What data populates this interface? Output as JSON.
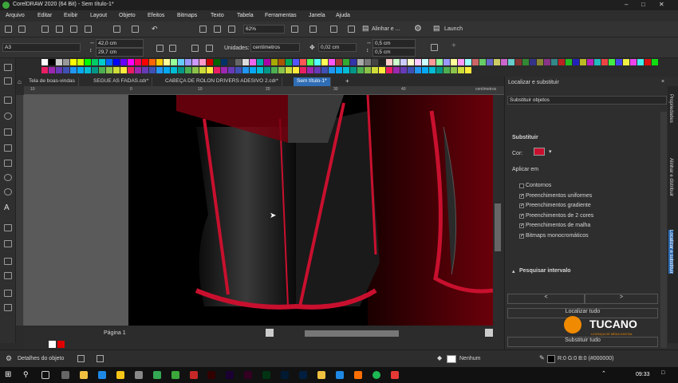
{
  "window": {
    "title": "CorelDRAW 2020 (64 Bit) - Sem título-1*"
  },
  "menu": [
    "Arquivo",
    "Editar",
    "Exibir",
    "Layout",
    "Objeto",
    "Efeitos",
    "Bitmaps",
    "Texto",
    "Tabela",
    "Ferramentas",
    "Janela",
    "Ajuda"
  ],
  "toolbar": {
    "zoom": "62%",
    "align_label": "Alinhar e ...",
    "launch_label": "Launch"
  },
  "propbar": {
    "page_size": "A3",
    "width": "42,0 cm",
    "height": "29,7 cm",
    "units_label": "Unidades:",
    "units_value": "centímetros",
    "nudge": "0,02 cm",
    "dup_x": "0,5 cm",
    "dup_y": "0,5 cm"
  },
  "tabs": [
    "Tela de boas-vindas",
    "SEGUE AS FADAS.cdr*",
    "CABEÇA DE ROLON DRIVERS ADESIVO 2.cdr*",
    "Sem título-1*"
  ],
  "ruler": {
    "unit": "centímetros",
    "ticks": [
      "10",
      "0",
      "10",
      "20",
      "30",
      "40",
      "50"
    ]
  },
  "page_nav": {
    "label": "Página 1"
  },
  "docker": {
    "title": "Localizar e substituir",
    "mode": "Substituir objetos",
    "section": "Substituir",
    "color_label": "Cor:",
    "apply_label": "Aplicar em",
    "options": [
      {
        "label": "Contornos",
        "checked": false
      },
      {
        "label": "Preenchimentos uniformes",
        "checked": true
      },
      {
        "label": "Preenchimentos gradiente",
        "checked": true
      },
      {
        "label": "Preenchimentos de 2 cores",
        "checked": true
      },
      {
        "label": "Preenchimentos de malha",
        "checked": true
      },
      {
        "label": "Bitmaps monocromáticos",
        "checked": true
      }
    ],
    "search_range": "Pesquisar intervalo",
    "prev": "<",
    "next": ">",
    "find_all": "Localizar tudo",
    "replace_all": "Substituir tudo",
    "side_tabs": [
      "Propriedades",
      "Alinhar e distribuir",
      "Localizar e substituir"
    ]
  },
  "watermark": {
    "brand": "TUCANO",
    "sub": "LICENÇA DE MÍDIA DIGITAL"
  },
  "status": {
    "object_details": "Detalhes do objeto",
    "fill": "Nenhum",
    "outline": "R:0 G:0 B:0 (#000000)"
  },
  "taskbar": {
    "time": "09:33"
  },
  "colors": {
    "accent": "#2f6db5",
    "red": "#c8102e",
    "dark": "#2e2e2e"
  }
}
